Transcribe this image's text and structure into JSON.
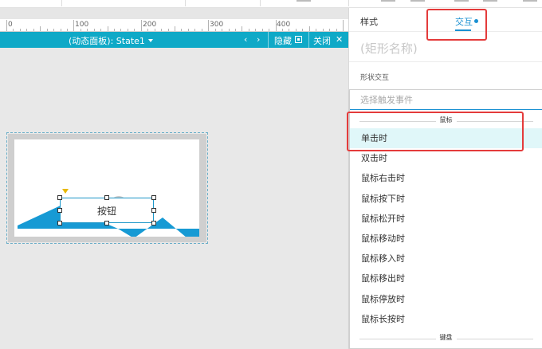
{
  "ruler": {
    "ticks": [
      "0",
      "100",
      "200",
      "300",
      "400"
    ]
  },
  "panel_bar": {
    "title": "(动态面板): State1",
    "prev_icon": "chevron-left-icon",
    "next_icon": "chevron-right-icon",
    "hide_label": "隐藏",
    "close_label": "关闭"
  },
  "canvas": {
    "button_label": "按钮",
    "colors": {
      "mountain": "#179ad4",
      "sun": "#c9c9c9",
      "selection": "#1b96c8"
    }
  },
  "right_panel": {
    "tabs": {
      "style": "样式",
      "interaction": "交互"
    },
    "shape_name_placeholder": "(矩形名称)",
    "section_label": "形状交互",
    "event_search_placeholder": "选择触发事件",
    "groups": {
      "mouse": "鼠标",
      "keyboard": "键盘"
    },
    "events": [
      "单击时",
      "双击时",
      "鼠标右击时",
      "鼠标按下时",
      "鼠标松开时",
      "鼠标移动时",
      "鼠标移入时",
      "鼠标移出时",
      "鼠标停放时",
      "鼠标长按时"
    ],
    "accent_color": "#1a90d2",
    "highlight_color": "#e43b3b"
  }
}
